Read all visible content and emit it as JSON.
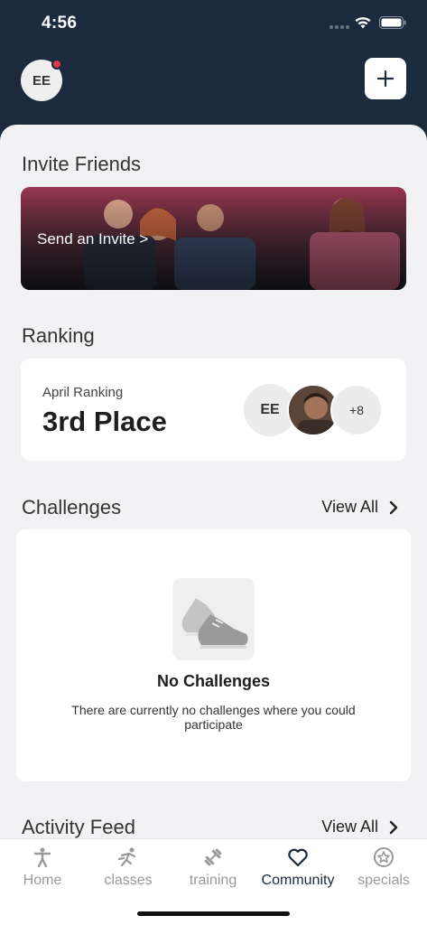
{
  "status_bar": {
    "time": "4:56"
  },
  "header": {
    "avatar_initials": "EE"
  },
  "invite": {
    "title": "Invite Friends",
    "cta": "Send an Invite >"
  },
  "ranking": {
    "title": "Ranking",
    "subtitle": "April Ranking",
    "place": "3rd Place",
    "avatar_initials": "EE",
    "more_count": "+8"
  },
  "challenges": {
    "title": "Challenges",
    "view_all": "View All",
    "empty_title": "No Challenges",
    "empty_desc": "There are currently no challenges where you could participate"
  },
  "activity": {
    "title": "Activity Feed",
    "view_all": "View All"
  },
  "tabs": [
    {
      "label": "Home",
      "icon": "person-icon"
    },
    {
      "label": "classes",
      "icon": "running-person-icon"
    },
    {
      "label": "training",
      "icon": "dumbbell-icon"
    },
    {
      "label": "Community",
      "icon": "heart-icon"
    },
    {
      "label": "specials",
      "icon": "star-badge-icon"
    }
  ],
  "colors": {
    "header_bg": "#1c2a3e",
    "notification": "#e0354a",
    "active_tab": "#1c2a3e",
    "inactive_tab": "#999999"
  }
}
